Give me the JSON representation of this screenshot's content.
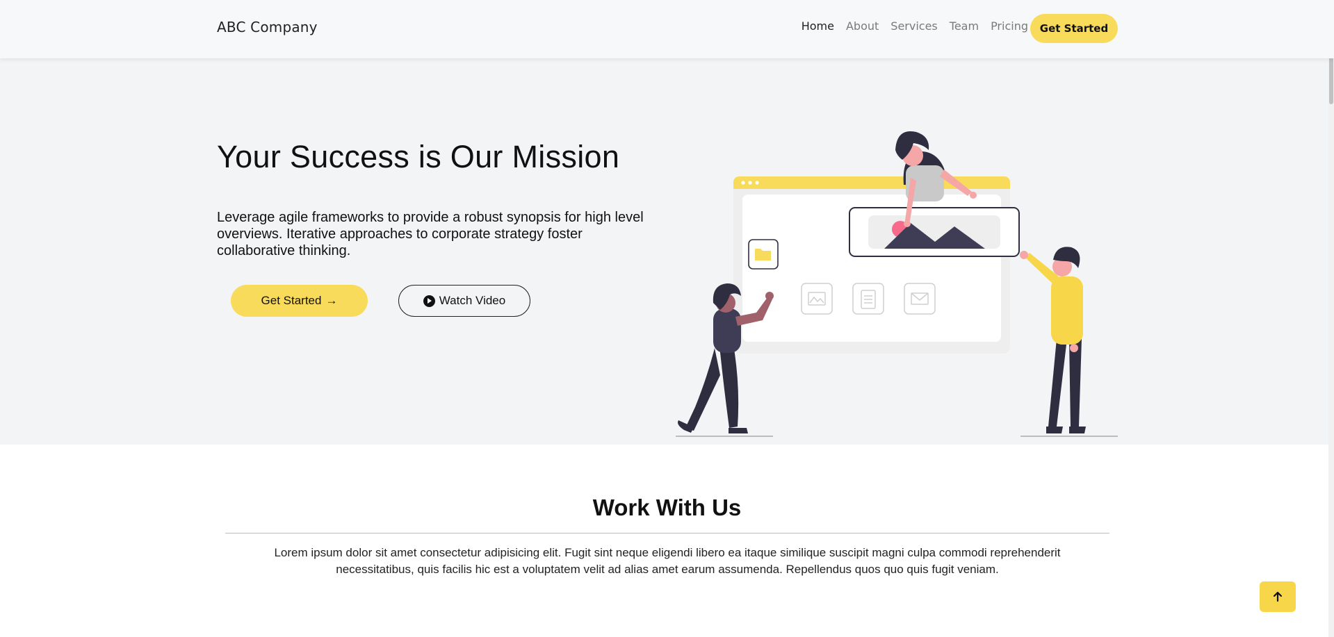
{
  "navbar": {
    "brand": "ABC Company",
    "links": [
      {
        "label": "Home",
        "active": true
      },
      {
        "label": "About",
        "active": false
      },
      {
        "label": "Services",
        "active": false
      },
      {
        "label": "Team",
        "active": false
      },
      {
        "label": "Pricing",
        "active": false
      }
    ],
    "cta_label": "Get Started"
  },
  "hero": {
    "title": "Your Success is Our Mission",
    "text": "Leverage agile frameworks to provide a robust synopsis for high level overviews. Iterative approaches to corporate strategy foster collaborative thinking.",
    "primary_button": "Get Started",
    "secondary_button": "Watch Video",
    "illustration": "people-with-web-browser-illustration"
  },
  "work": {
    "title": "Work With Us",
    "text": "Lorem ipsum dolor sit amet consectetur adipisicing elit. Fugit sint neque eligendi libero ea itaque similique suscipit magni culpa commodi reprehenderit necessitatibus, quis facilis hic est a voluptatem velit ad alias amet earum assumenda. Repellendus quos quo quis fugit veniam."
  },
  "colors": {
    "accent": "#f8db5a",
    "hero_bg": "#f3f4f6",
    "navbar_bg": "#f7f8fa",
    "dark_figure": "#2f2e41",
    "pink": "#f86a8a"
  },
  "icons": {
    "back_to_top": "arrow-up-icon",
    "play": "play-circle-icon",
    "arrow": "arrow-right-icon"
  }
}
